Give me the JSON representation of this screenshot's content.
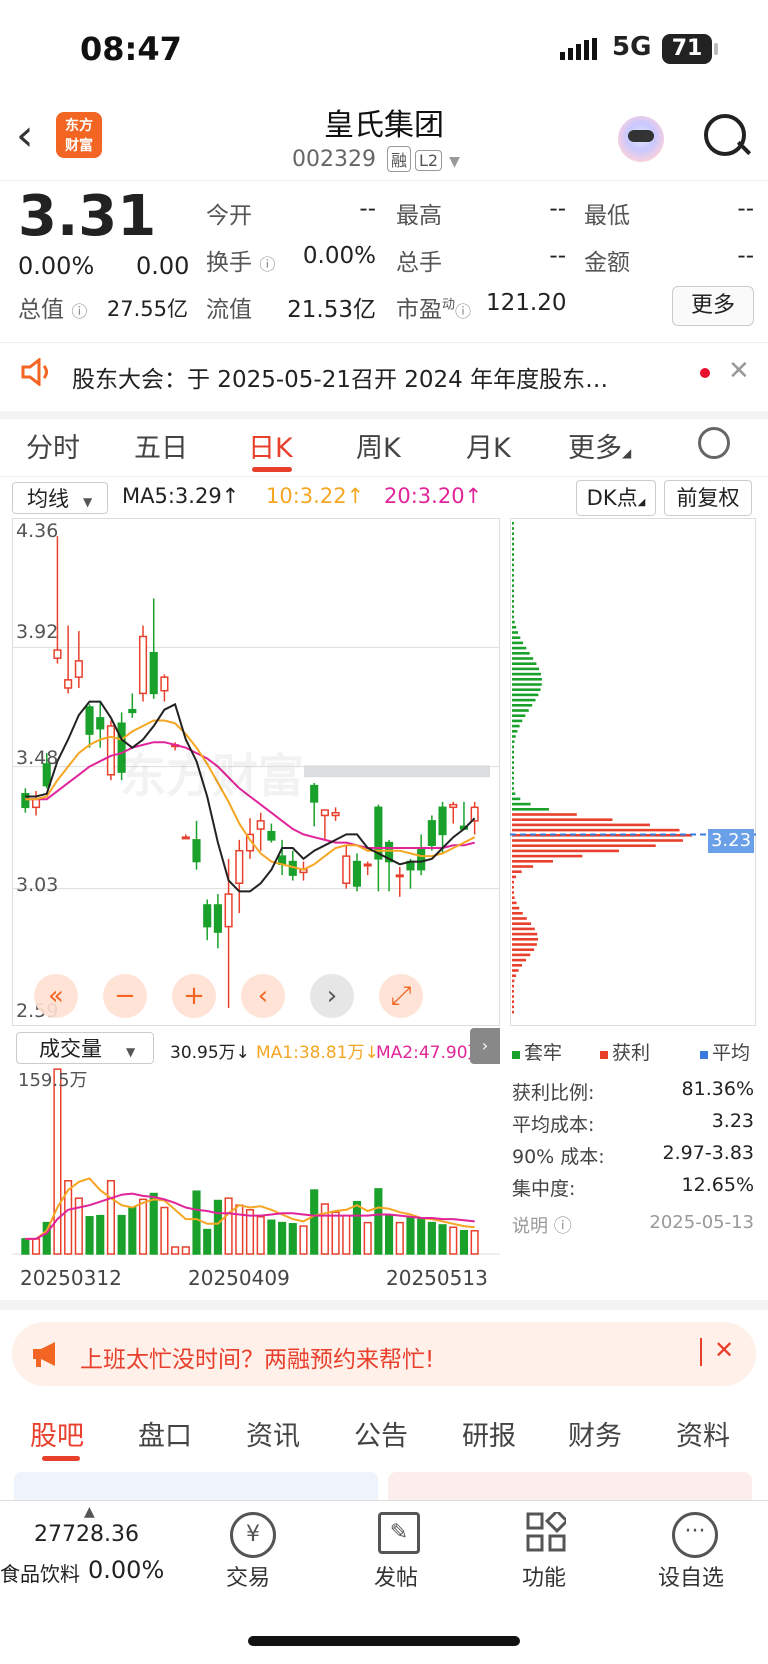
{
  "status": {
    "time": "08:47",
    "network": "5G",
    "battery": "71"
  },
  "header": {
    "name": "皇氏集团",
    "code": "002329",
    "tag_rong": "融",
    "tag_l2": "L2",
    "logo_line1": "东方",
    "logo_line2": "财富"
  },
  "quote": {
    "price": "3.31",
    "change_pct": "0.00%",
    "change_val": "0.00",
    "open_label": "今开",
    "open": "--",
    "high_label": "最高",
    "high": "--",
    "low_label": "最低",
    "low": "--",
    "turnover_label": "换手",
    "turnover": "0.00%",
    "volume_label": "总手",
    "volume": "--",
    "amount_label": "金额",
    "amount": "--",
    "mcap_label": "总值",
    "mcap": "27.55亿",
    "float_label": "流值",
    "float": "21.53亿",
    "pe_label": "市盈",
    "pe_sup": "动",
    "pe": "121.20",
    "more": "更多"
  },
  "notice": {
    "text": "股东大会：于 2025-05-21召开 2024 年年度股东…"
  },
  "tabs": [
    "分时",
    "五日",
    "日K",
    "周K",
    "月K",
    "更多"
  ],
  "ma_bar": {
    "selector": "均线",
    "ma5": "MA5:3.29↑",
    "ma10": "10:3.22↑",
    "ma20": "20:3.20↑",
    "dk": "DK点",
    "fq": "前复权"
  },
  "chart_labels": {
    "y_top": "4.36",
    "y_1": "3.92",
    "y_2": "3.48",
    "y_3": "3.03",
    "y_bot": "2.59",
    "cost_tag": "3.23",
    "watermark": "东方财富"
  },
  "vol_bar": {
    "selector": "成交量",
    "vol": "30.95万↓",
    "ma1": "MA1:38.81万↓",
    "ma2": "MA2:47.90万↓",
    "max": "159.5万"
  },
  "dates": [
    "20250312",
    "20250409",
    "20250513"
  ],
  "dist": {
    "legend": [
      "套牢",
      "获利",
      "平均"
    ],
    "rows": [
      {
        "label": "获利比例:",
        "value": "81.36%"
      },
      {
        "label": "平均成本:",
        "value": "3.23"
      },
      {
        "label": "90% 成本:",
        "value": "2.97-3.83"
      },
      {
        "label": "集中度:",
        "value": "12.65%"
      }
    ],
    "note": "说明",
    "date": "2025-05-13"
  },
  "banner": {
    "text": "上班太忙没时间？两融预约来帮忙!"
  },
  "bottom_tabs": [
    "股吧",
    "盘口",
    "资讯",
    "公告",
    "研报",
    "财务",
    "资料"
  ],
  "bottom_nav": {
    "index_value": "27728.36",
    "index_name": "食品饮料",
    "index_change": "0.00%",
    "trade": "交易",
    "post": "发帖",
    "func": "功能",
    "watch": "设自选"
  },
  "colors": {
    "up": "#e8402c",
    "down": "#1aa12b",
    "ma5": "#222222",
    "ma10": "#f5a623",
    "ma20": "#e0249a",
    "accent": "#f26522"
  },
  "chart_data": {
    "type": "candlestick",
    "ylim": [
      2.59,
      4.36
    ],
    "candles": [
      [
        3.38,
        3.33,
        3.4,
        3.31
      ],
      [
        3.33,
        3.36,
        3.39,
        3.3
      ],
      [
        3.49,
        3.41,
        3.53,
        3.4
      ],
      [
        3.88,
        3.91,
        4.33,
        3.86
      ],
      [
        3.77,
        3.8,
        4.0,
        3.75
      ],
      [
        3.81,
        3.87,
        3.98,
        3.77
      ],
      [
        3.7,
        3.6,
        3.71,
        3.55
      ],
      [
        3.66,
        3.62,
        3.72,
        3.55
      ],
      [
        3.45,
        3.63,
        3.65,
        3.43
      ],
      [
        3.64,
        3.46,
        3.68,
        3.43
      ],
      [
        3.69,
        3.68,
        3.75,
        3.66
      ],
      [
        3.75,
        3.96,
        4.0,
        3.72
      ],
      [
        3.9,
        3.75,
        4.1,
        3.73
      ],
      [
        3.76,
        3.81,
        3.82,
        3.72
      ],
      [
        3.56,
        3.56,
        3.57,
        3.54
      ],
      [
        3.22,
        3.22,
        3.23,
        3.22
      ],
      [
        3.21,
        3.13,
        3.28,
        3.1
      ],
      [
        2.97,
        2.89,
        2.99,
        2.84
      ],
      [
        2.97,
        2.87,
        3.01,
        2.81
      ],
      [
        2.89,
        3.01,
        3.14,
        2.59
      ],
      [
        3.05,
        3.17,
        3.21,
        2.94
      ],
      [
        3.17,
        3.23,
        3.29,
        3.14
      ],
      [
        3.25,
        3.28,
        3.31,
        3.17
      ],
      [
        3.24,
        3.21,
        3.27,
        3.2
      ],
      [
        3.15,
        3.12,
        3.21,
        3.08
      ],
      [
        3.13,
        3.08,
        3.17,
        3.06
      ],
      [
        3.09,
        3.1,
        3.13,
        3.06
      ],
      [
        3.41,
        3.35,
        3.42,
        3.26
      ],
      [
        3.3,
        3.32,
        3.32,
        3.21
      ],
      [
        3.3,
        3.31,
        3.33,
        3.28
      ],
      [
        3.05,
        3.15,
        3.19,
        3.03
      ],
      [
        3.13,
        3.04,
        3.16,
        3.02
      ],
      [
        3.12,
        3.12,
        3.13,
        3.08
      ],
      [
        3.33,
        3.14,
        3.34,
        3.02
      ],
      [
        3.2,
        3.13,
        3.21,
        3.02
      ],
      [
        3.08,
        3.08,
        3.11,
        3.0
      ],
      [
        3.13,
        3.1,
        3.14,
        3.03
      ],
      [
        3.18,
        3.1,
        3.23,
        3.08
      ],
      [
        3.28,
        3.19,
        3.3,
        3.17
      ],
      [
        3.33,
        3.23,
        3.35,
        3.16
      ],
      [
        3.33,
        3.34,
        3.35,
        3.27
      ],
      [
        3.26,
        3.25,
        3.35,
        3.25
      ],
      [
        3.28,
        3.33,
        3.35,
        3.23
      ]
    ],
    "volumes": [
      0.13,
      0.13,
      0.27,
      1.59,
      0.63,
      0.48,
      0.32,
      0.33,
      0.63,
      0.33,
      0.4,
      0.47,
      0.52,
      0.4,
      0.06,
      0.06,
      0.54,
      0.21,
      0.46,
      0.48,
      0.42,
      0.38,
      0.32,
      0.29,
      0.27,
      0.26,
      0.24,
      0.55,
      0.43,
      0.36,
      0.33,
      0.45,
      0.27,
      0.56,
      0.33,
      0.27,
      0.32,
      0.31,
      0.27,
      0.25,
      0.23,
      0.2,
      0.2
    ],
    "ma5": [
      3.37,
      3.37,
      3.38,
      3.5,
      3.58,
      3.67,
      3.72,
      3.72,
      3.66,
      3.58,
      3.55,
      3.58,
      3.63,
      3.69,
      3.71,
      3.58,
      3.5,
      3.37,
      3.2,
      3.06,
      3.02,
      3.02,
      3.05,
      3.1,
      3.18,
      3.18,
      3.14,
      3.17,
      3.19,
      3.21,
      3.23,
      3.23,
      3.18,
      3.16,
      3.14,
      3.12,
      3.13,
      3.13,
      3.14,
      3.18,
      3.22,
      3.25,
      3.29
    ],
    "ma10": [
      3.36,
      3.36,
      3.37,
      3.43,
      3.48,
      3.53,
      3.56,
      3.58,
      3.59,
      3.58,
      3.61,
      3.63,
      3.65,
      3.65,
      3.64,
      3.6,
      3.55,
      3.49,
      3.42,
      3.35,
      3.27,
      3.21,
      3.16,
      3.13,
      3.12,
      3.11,
      3.1,
      3.12,
      3.15,
      3.18,
      3.19,
      3.19,
      3.17,
      3.17,
      3.17,
      3.17,
      3.16,
      3.15,
      3.15,
      3.16,
      3.18,
      3.2,
      3.22
    ],
    "ma20": [
      3.36,
      3.36,
      3.36,
      3.39,
      3.42,
      3.45,
      3.48,
      3.5,
      3.52,
      3.53,
      3.55,
      3.56,
      3.57,
      3.57,
      3.56,
      3.55,
      3.53,
      3.51,
      3.48,
      3.44,
      3.4,
      3.37,
      3.34,
      3.31,
      3.28,
      3.25,
      3.23,
      3.22,
      3.21,
      3.2,
      3.2,
      3.19,
      3.18,
      3.18,
      3.18,
      3.18,
      3.18,
      3.18,
      3.18,
      3.18,
      3.19,
      3.19,
      3.2
    ],
    "vol_ma1": [
      0.13,
      0.13,
      0.2,
      0.4,
      0.55,
      0.62,
      0.65,
      0.55,
      0.48,
      0.42,
      0.4,
      0.44,
      0.47,
      0.46,
      0.38,
      0.3,
      0.3,
      0.26,
      0.26,
      0.35,
      0.42,
      0.4,
      0.41,
      0.38,
      0.34,
      0.3,
      0.28,
      0.33,
      0.35,
      0.37,
      0.38,
      0.42,
      0.37,
      0.4,
      0.39,
      0.36,
      0.34,
      0.31,
      0.3,
      0.28,
      0.26,
      0.24,
      0.23
    ],
    "vol_ma2": [
      0.13,
      0.13,
      0.18,
      0.3,
      0.38,
      0.4,
      0.42,
      0.45,
      0.48,
      0.51,
      0.52,
      0.5,
      0.49,
      0.47,
      0.44,
      0.4,
      0.38,
      0.37,
      0.35,
      0.35,
      0.34,
      0.33,
      0.33,
      0.34,
      0.35,
      0.35,
      0.34,
      0.33,
      0.33,
      0.33,
      0.33,
      0.33,
      0.33,
      0.34,
      0.34,
      0.33,
      0.32,
      0.31,
      0.31,
      0.3,
      0.3,
      0.29,
      0.28
    ]
  }
}
